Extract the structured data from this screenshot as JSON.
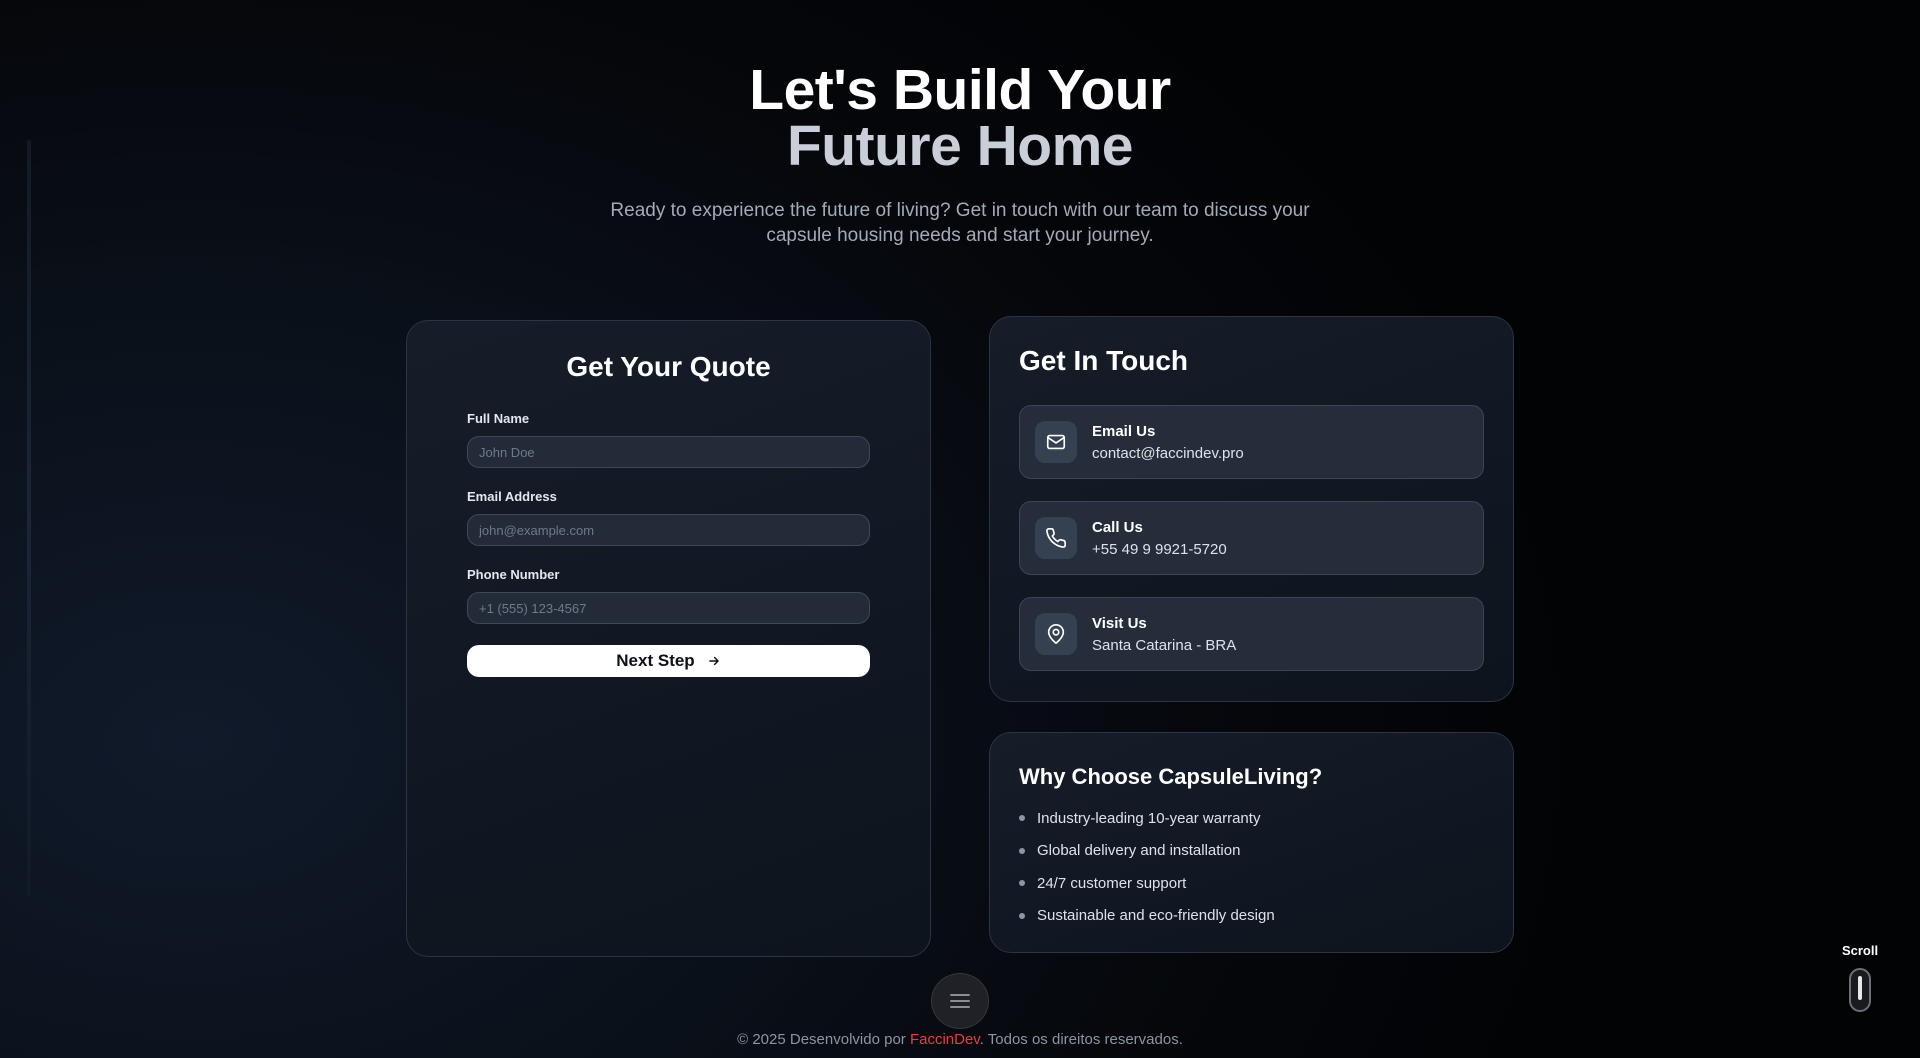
{
  "hero": {
    "title_line1": "Let's Build Your",
    "title_line2": "Future Home",
    "subtitle": "Ready to experience the future of living? Get in touch with our team to discuss your capsule housing needs and start your journey."
  },
  "quote_form": {
    "title": "Get Your Quote",
    "fields": [
      {
        "label": "Full Name",
        "placeholder": "John Doe",
        "value": ""
      },
      {
        "label": "Email Address",
        "placeholder": "john@example.com",
        "value": ""
      },
      {
        "label": "Phone Number",
        "placeholder": "+1 (555) 123-4567",
        "value": ""
      }
    ],
    "next_button": "Next Step",
    "next_icon": "arrow-right-icon"
  },
  "contact": {
    "title": "Get In Touch",
    "items": [
      {
        "icon": "mail-icon",
        "label": "Email Us",
        "value": "contact@faccindev.pro"
      },
      {
        "icon": "phone-icon",
        "label": "Call Us",
        "value": "+55 49 9 9921-5720"
      },
      {
        "icon": "map-pin-icon",
        "label": "Visit Us",
        "value": "Santa Catarina - BRA"
      }
    ]
  },
  "why": {
    "title": "Why Choose CapsuleLiving?",
    "items": [
      "Industry-leading 10-year warranty",
      "Global delivery and installation",
      "24/7 customer support",
      "Sustainable and eco-friendly design"
    ]
  },
  "menu": {
    "icon": "hamburger-menu-icon"
  },
  "footer": {
    "prefix": "© 2025 Desenvolvido por ",
    "brand": "FaccinDev",
    "suffix": ". Todos os direitos reservados.",
    "brand_color": "#ef3a3a"
  },
  "scroll_indicator": {
    "label": "Scroll",
    "icon": "mouse-scroll-icon"
  },
  "colors": {
    "background": "#05070b",
    "card": "#131a25",
    "accent": "#ffffff"
  }
}
